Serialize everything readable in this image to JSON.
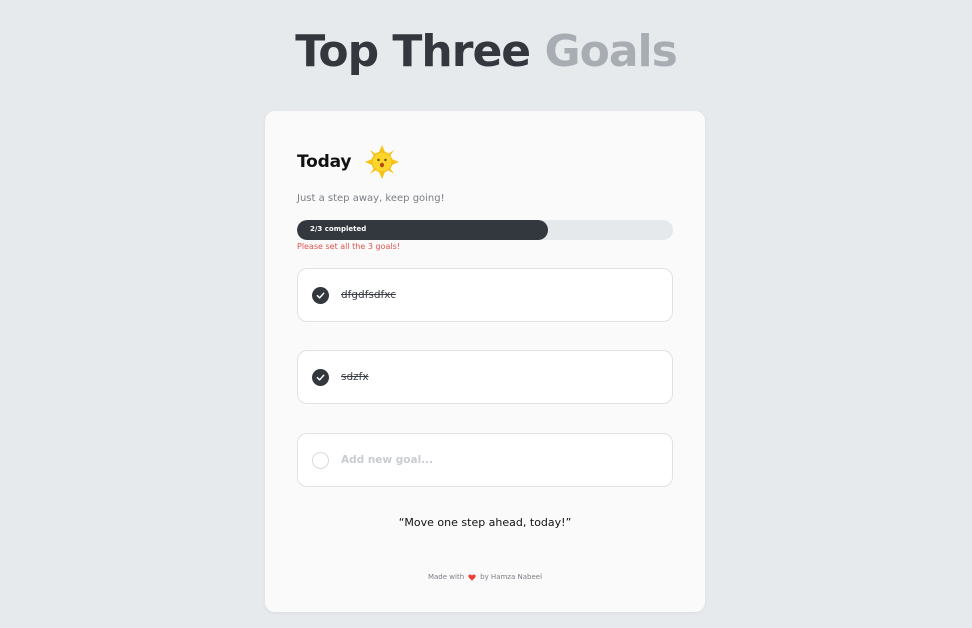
{
  "header": {
    "title_main": "Top Three",
    "title_accent": "Goals"
  },
  "card": {
    "heading": "Today",
    "heading_icon": "sun-emoji-icon",
    "subtitle": "Just a step away, keep going!",
    "progress": {
      "label": "2/3 completed",
      "completed": 2,
      "total": 3,
      "fraction": 0.667
    },
    "error": "Please set all the 3 goals!",
    "goals": [
      {
        "text": "dfgdfsdfxc",
        "completed": true
      },
      {
        "text": "sdzfx",
        "completed": true
      },
      {
        "text": "",
        "placeholder": "Add new goal...",
        "completed": false
      }
    ],
    "quote": "“Move one step ahead, today!”",
    "footer": {
      "prefix": "Made with",
      "icon": "heart-icon",
      "suffix": "by Hamza Nabeel"
    }
  },
  "colors": {
    "background": "#e7eaed",
    "dark": "#33383e",
    "accent_gray": "#a7adb3",
    "error": "#e0554f",
    "heart": "#e8403a"
  }
}
